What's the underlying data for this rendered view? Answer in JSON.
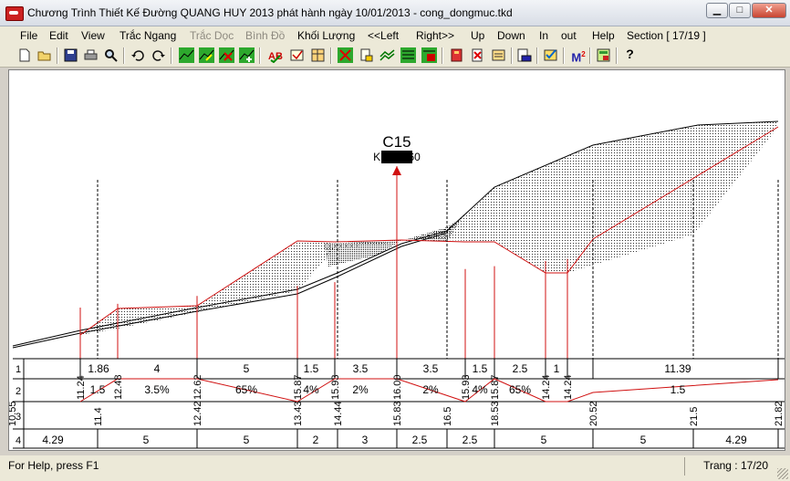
{
  "window": {
    "title": "Chương Trình Thiết Kế Đường QUANG HUY 2013 phát hành ngày 10/01/2013 - cong_dongmuc.tkd",
    "min_label": "▁",
    "max_label": "□",
    "close_label": "✕"
  },
  "menu": {
    "file": "File",
    "edit": "Edit",
    "view": "View",
    "trac_ngang": "Trắc Ngang",
    "trac_doc": "Trắc Dọc",
    "binh_do": "Bình Đồ",
    "khoi_luong": "Khối Lượng",
    "left": "<<Left",
    "right": "Right>>",
    "up": "Up",
    "down": "Down",
    "in": "In",
    "out": "out",
    "help": "Help",
    "section": "Section [ 17/19 ]"
  },
  "toolbar": {
    "icons": [
      "new-icon",
      "open-icon",
      "save-icon",
      "print-icon",
      "find-icon",
      "undo-icon",
      "redo-icon",
      "terrain-icon",
      "terrain-edit-icon",
      "terrain-delete-icon",
      "terrain-add-icon",
      "spell-icon",
      "table-icon",
      "sheet-icon",
      "cross-icon",
      "lock-icon",
      "layers-icon",
      "grid-icon",
      "grid-color-icon",
      "book-icon",
      "delete-doc-icon",
      "note-icon",
      "export-icon",
      "check-icon",
      "area-icon",
      "calc-icon",
      "help-icon"
    ],
    "area_label": "M",
    "area_sup": "2",
    "help_glyph": "?"
  },
  "section": {
    "name": "C15",
    "station": "KM0+360"
  },
  "table": {
    "row_numbers": [
      "1",
      "2",
      "3",
      "4"
    ],
    "row1": [
      "1.86",
      "4",
      "5",
      "1.5",
      "3.5",
      "3.5",
      "1.5",
      "2.5",
      "1",
      "11.39"
    ],
    "row2_elev": [
      "11.24",
      "12.48",
      "12.62",
      "15.87",
      "15.93",
      "16.00",
      "15.93",
      "15.87",
      "14.24",
      "14.24"
    ],
    "row2_slope": [
      "1.5",
      "3.5%",
      "65%",
      "4%",
      "2%",
      "2%",
      "4%",
      "65%",
      "1.5"
    ],
    "row3": [
      "10.55",
      "11.4",
      "12.42",
      "13.43",
      "14.44",
      "15.83",
      "16.5",
      "18.53",
      "20.52",
      "21.5",
      "21.82"
    ],
    "row4": [
      "4.29",
      "5",
      "5",
      "2",
      "3",
      "2.5",
      "2.5",
      "5",
      "5",
      "4.29"
    ]
  },
  "status": {
    "help": "For Help, press F1",
    "page": "Trang : 17/20"
  },
  "colors": {
    "design_line": "#d01010",
    "ground_line": "#000000"
  }
}
